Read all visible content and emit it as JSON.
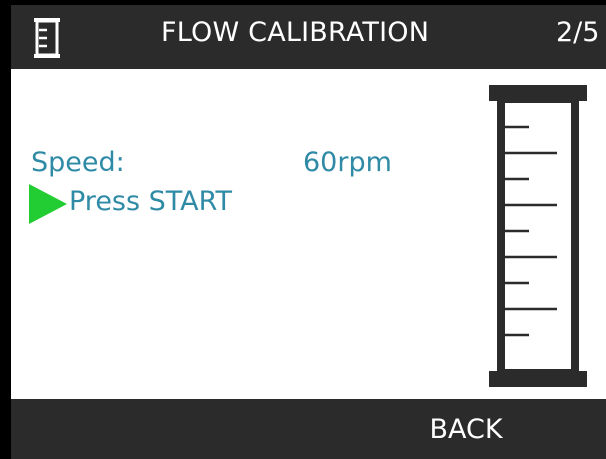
{
  "header": {
    "icon": "graduated-cylinder-icon",
    "title": "FLOW CALIBRATION",
    "page": "2/5"
  },
  "main": {
    "speed_label": "Speed:",
    "speed_value": "60rpm",
    "prompt_icon": "play-arrow-icon",
    "prompt_text": "Press START",
    "illustration": "graduated-cylinder-icon"
  },
  "footer": {
    "back_label": "BACK"
  },
  "colors": {
    "header_bg": "#2b2b2b",
    "text_accent": "#2f8aa6",
    "play_arrow": "#22cc33",
    "content_bg": "#ffffff"
  }
}
